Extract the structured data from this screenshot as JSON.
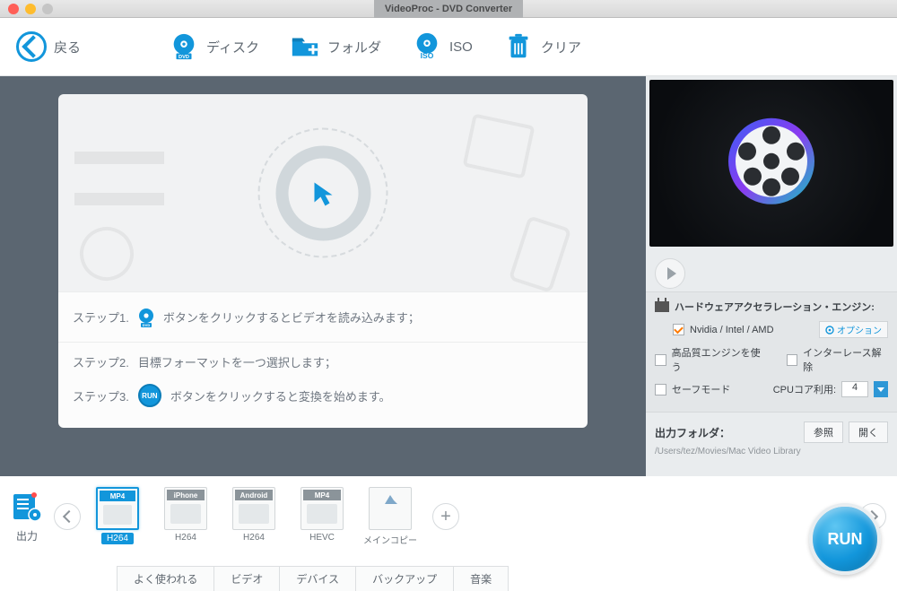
{
  "window": {
    "title": "VideoProc - DVD Converter"
  },
  "toolbar": {
    "back": "戻る",
    "disc": "ディスク",
    "folder": "フォルダ",
    "iso": "ISO",
    "clear": "クリア"
  },
  "steps": {
    "s1_prefix": "ステップ1.",
    "s1_text": "ボタンをクリックするとビデオを読み込みます；",
    "s2_prefix": "ステップ2.",
    "s2_text": "目標フォーマットを一つ選択します；",
    "s3_prefix": "ステップ3.",
    "s3_badge": "RUN",
    "s3_text": "ボタンをクリックすると変換を始めます。"
  },
  "accel": {
    "title": "ハードウェアアクセラレーション・エンジン:",
    "gpus": "Nvidia /  Intel / AMD",
    "option": "オプション",
    "hq": "高品質エンジンを使う",
    "deint": "インターレース解除",
    "safe": "セーフモード",
    "cpu_label": "CPUコア利用:",
    "cpu_value": "4"
  },
  "output_folder": {
    "label": "出力フォルダ：",
    "browse": "参照",
    "open": "開く",
    "path": "/Users/tez/Movies/Mac Video Library"
  },
  "output_btn": "出力",
  "formats": [
    {
      "top": "MP4",
      "bottom": "H264",
      "selected": true
    },
    {
      "top": "iPhone",
      "bottom": "H264",
      "selected": false
    },
    {
      "top": "Android",
      "bottom": "H264",
      "selected": false
    },
    {
      "top": "MP4",
      "bottom": "HEVC",
      "selected": false
    },
    {
      "top": "",
      "bottom": "メインコピー",
      "selected": false,
      "backup": true
    }
  ],
  "tabs": [
    "よく使われる",
    "ビデオ",
    "デバイス",
    "バックアップ",
    "音楽"
  ],
  "run": "RUN"
}
